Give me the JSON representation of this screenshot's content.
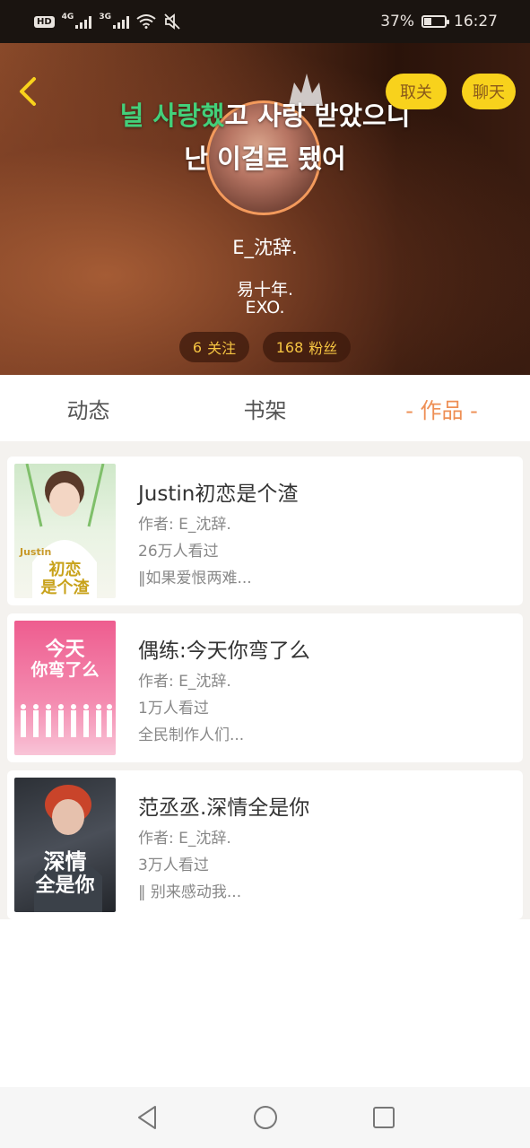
{
  "status_bar": {
    "hd": "HD",
    "net1": "4G",
    "net2": "3G",
    "battery_text": "37%",
    "battery_level": 0.37,
    "time": "16:27"
  },
  "header": {
    "lyrics_line1_highlight": "널 사랑했",
    "lyrics_line1_rest": "고 사랑 받았으니",
    "lyrics_line2": "난 이걸로 됐어",
    "unfollow_label": "取关",
    "chat_label": "聊天",
    "username": "E_沈辞.",
    "bio_line1": "易十年.",
    "bio_line2": "EXO.",
    "follow_count": "6",
    "follow_label": "关注",
    "fans_count": "168",
    "fans_label": "粉丝"
  },
  "tabs": [
    {
      "label": "动态"
    },
    {
      "label": "书架"
    },
    {
      "label": "- 作品 -"
    }
  ],
  "works": [
    {
      "title": "Justin初恋是个渣",
      "author": "作者: E_沈辞.",
      "views": "26万人看过",
      "intro": "‖如果爱恨两难...",
      "cover_text_1": "Justin",
      "cover_text_2": "初恋",
      "cover_text_3": "是个渣"
    },
    {
      "title": "偶练:今天你弯了么",
      "author": "作者: E_沈辞.",
      "views": "1万人看过",
      "intro": "全民制作人们...",
      "cover_text_1": "今天",
      "cover_text_2": "你弯了么"
    },
    {
      "title": "范丞丞.深情全是你",
      "author": "作者: E_沈辞.",
      "views": "3万人看过",
      "intro": "‖ 别来感动我...",
      "cover_text_1": "深情",
      "cover_text_2": "全是你"
    }
  ],
  "colors": {
    "accent": "#ee8f55",
    "button_yellow": "#f8d21c",
    "lyrics_highlight": "#43d07a"
  }
}
